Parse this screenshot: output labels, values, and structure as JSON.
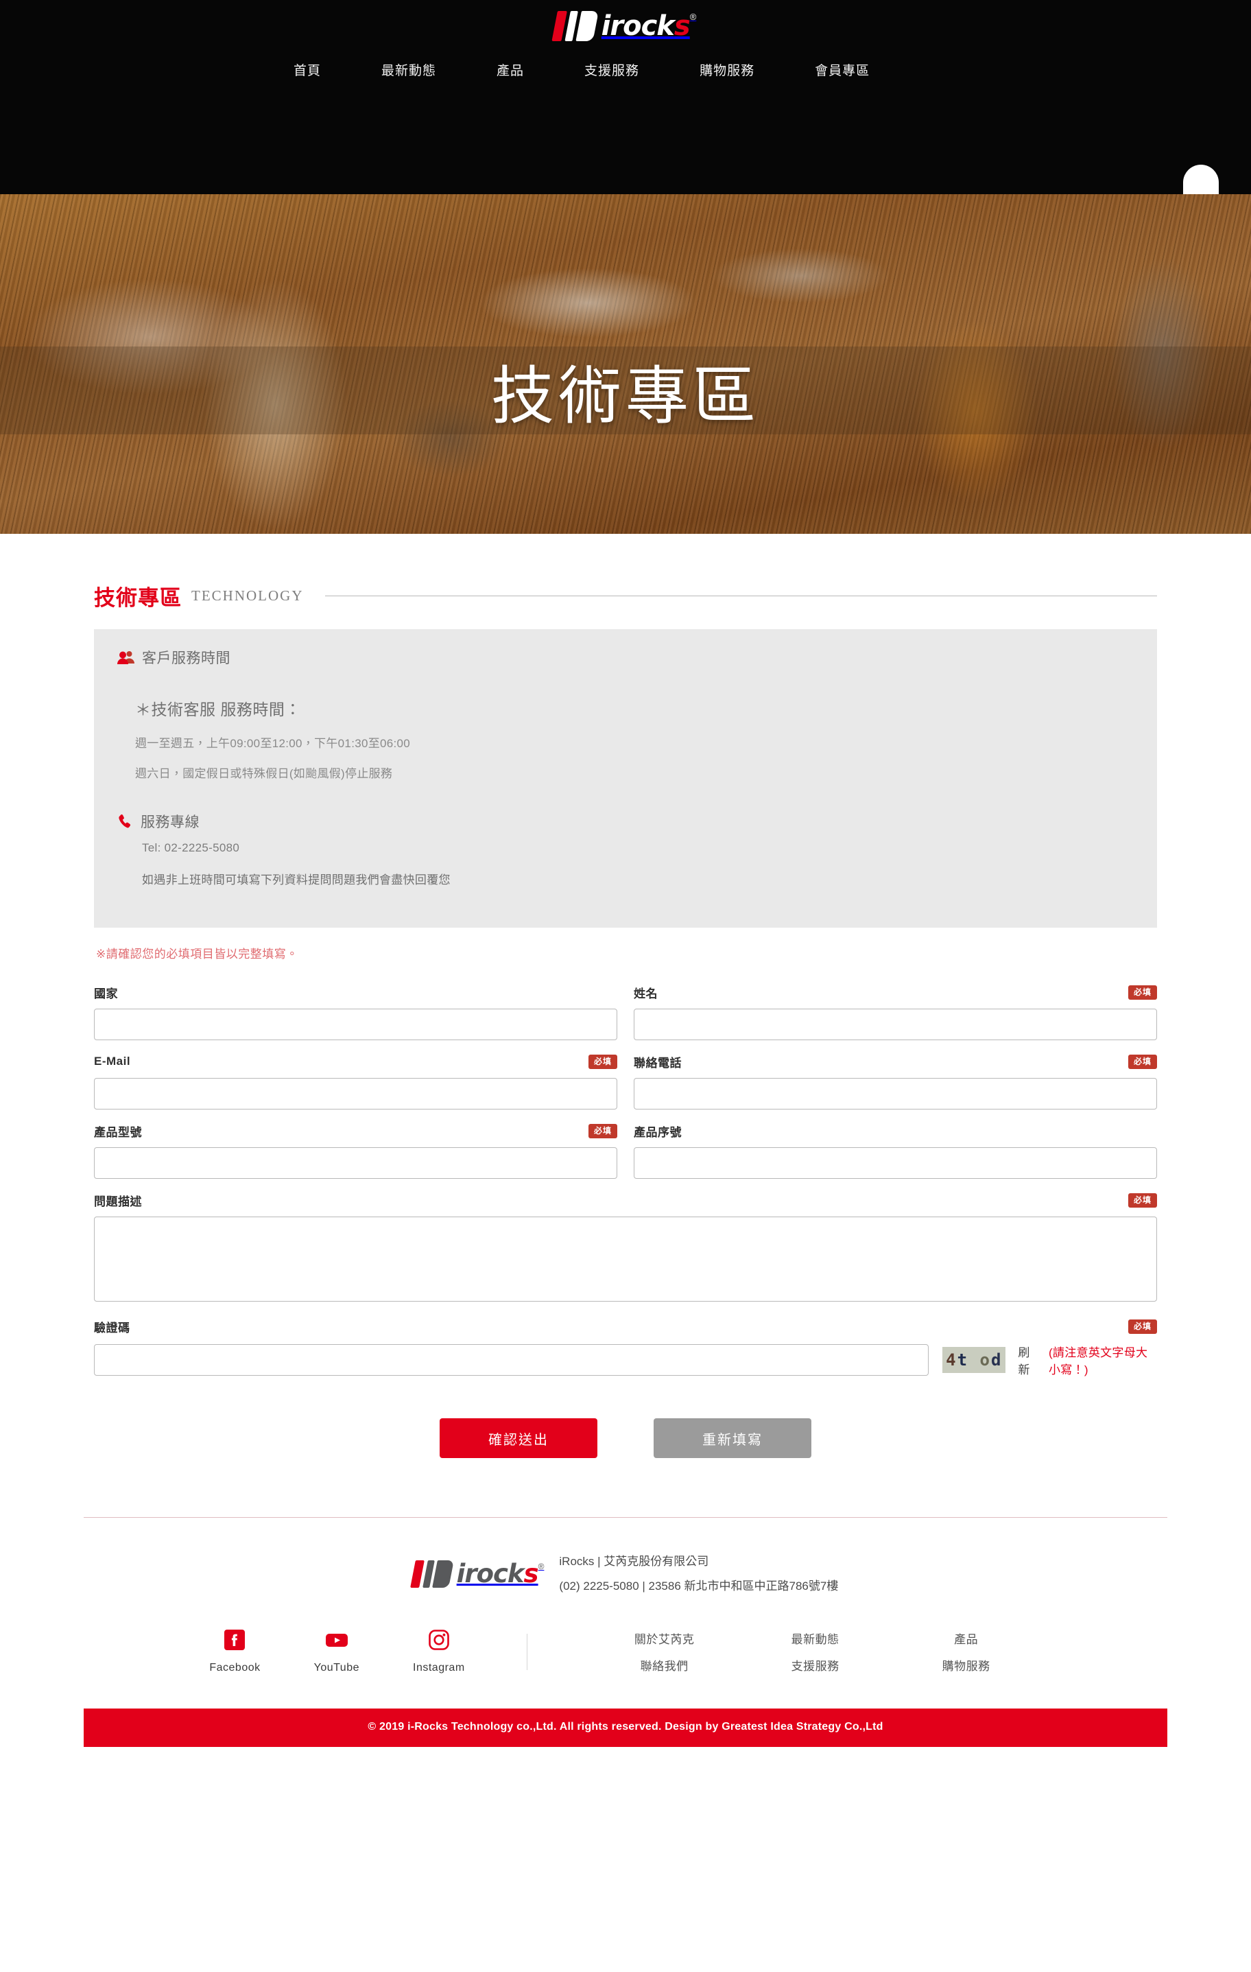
{
  "header": {
    "logo": {
      "text": "irocks",
      "last_letter": "s",
      "registered": "®",
      "icon": "irocks-logo"
    },
    "nav": [
      {
        "label": "首頁",
        "name": "nav-home"
      },
      {
        "label": "最新動態",
        "name": "nav-news"
      },
      {
        "label": "產品",
        "name": "nav-products"
      },
      {
        "label": "支援服務",
        "name": "nav-support"
      },
      {
        "label": "購物服務",
        "name": "nav-shopping"
      },
      {
        "label": "會員專區",
        "name": "nav-member"
      }
    ]
  },
  "hero": {
    "title": "技術專區"
  },
  "section": {
    "title_zh": "技術專區",
    "title_en": "TECHNOLOGY"
  },
  "info": {
    "service_hours_heading": "客戶服務時間",
    "service_hours_sub": "＊技術客服 服務時間：",
    "service_hours_line1": "週一至週五，上午09:00至12:00，下午01:30至06:00",
    "service_hours_line2": "週六日，國定假日或特殊假日(如颱風假)停止服務",
    "hotline_heading": "服務專線",
    "hotline_tel": "Tel: 02-2225-5080",
    "hotline_note": "如遇非上班時間可填寫下列資料提問問題我們會盡快回覆您"
  },
  "form": {
    "warning": "※請確認您的必填項目皆以完整填寫。",
    "required_badge": "必填",
    "fields": [
      {
        "label": "國家",
        "required": false,
        "value": "",
        "placeholder": "",
        "name": "country"
      },
      {
        "label": "姓名",
        "required": true,
        "value": "",
        "placeholder": "",
        "name": "name"
      },
      {
        "label": "E-Mail",
        "required": true,
        "value": "",
        "placeholder": "",
        "name": "email"
      },
      {
        "label": "聯絡電話",
        "required": true,
        "value": "",
        "placeholder": "",
        "name": "phone"
      },
      {
        "label": "產品型號",
        "required": true,
        "value": "",
        "placeholder": "",
        "name": "product-model"
      },
      {
        "label": "產品序號",
        "required": false,
        "value": "",
        "placeholder": "",
        "name": "product-serial"
      },
      {
        "label": "問題描述",
        "required": true,
        "value": "",
        "placeholder": "",
        "name": "description"
      },
      {
        "label": "驗證碼",
        "required": true,
        "value": "",
        "placeholder": "",
        "name": "captcha"
      }
    ],
    "captcha": {
      "code": "4t od",
      "c1": "4",
      "c2": "t",
      "c3": "o",
      "c4": "d",
      "refresh_label": "刷新",
      "hint": "(請注意英文字母大小寫！)"
    },
    "submit_label": "確認送出",
    "reset_label": "重新填寫"
  },
  "footer": {
    "company_line1": "iRocks | 艾芮克股份有限公司",
    "company_line2": "(02) 2225-5080 | 23586 新北市中和區中正路786號7樓",
    "social": [
      {
        "label": "Facebook",
        "icon": "facebook-icon"
      },
      {
        "label": "YouTube",
        "icon": "youtube-icon"
      },
      {
        "label": "Instagram",
        "icon": "instagram-icon"
      }
    ],
    "links": [
      {
        "top": "關於艾芮克",
        "bottom": "聯絡我們"
      },
      {
        "top": "最新動態",
        "bottom": "支援服務"
      },
      {
        "top": "產品",
        "bottom": "購物服務"
      }
    ],
    "copyright": "© 2019 i-Rocks Technology co.,Ltd. All rights reserved. Design by Greatest Idea Strategy Co.,Ltd"
  },
  "colors": {
    "brand_red": "#e2001a",
    "badge_red": "#c0392b",
    "panel_gray": "#e9e9e9",
    "reset_gray": "#9b9b9b"
  }
}
